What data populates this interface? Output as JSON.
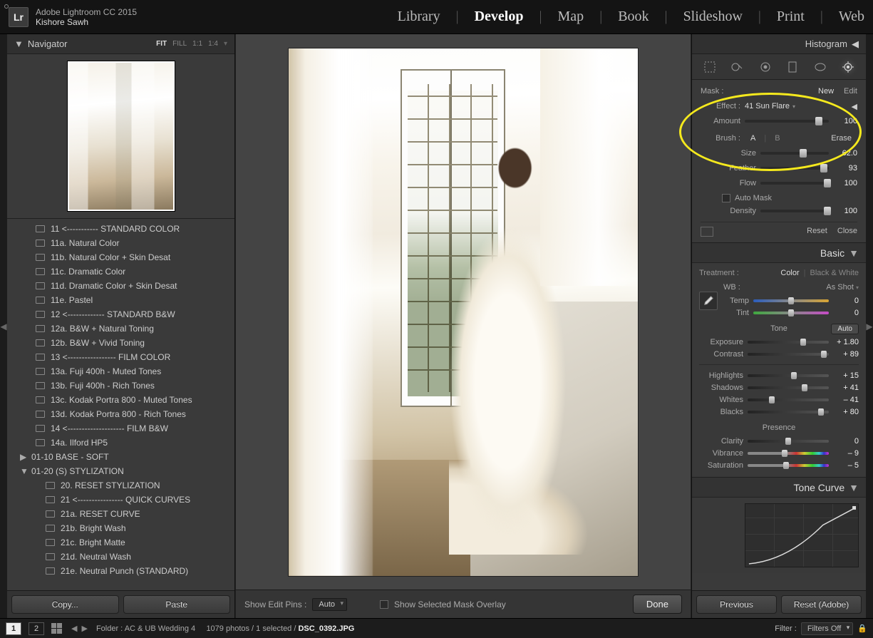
{
  "app": {
    "logo_text": "Lr",
    "title": "Adobe Lightroom CC 2015",
    "user": "Kishore Sawh"
  },
  "modules": {
    "library": "Library",
    "develop": "Develop",
    "map": "Map",
    "book": "Book",
    "slideshow": "Slideshow",
    "print": "Print",
    "web": "Web"
  },
  "navigator": {
    "title": "Navigator",
    "zoom": {
      "fit": "FIT",
      "fill": "FILL",
      "one": "1:1",
      "four": "1:4"
    }
  },
  "presets": [
    {
      "label": "11 <----------- STANDARD COLOR",
      "depth": 1
    },
    {
      "label": "11a. Natural Color",
      "depth": 1
    },
    {
      "label": "11b. Natural Color + Skin Desat",
      "depth": 1
    },
    {
      "label": "11c. Dramatic Color",
      "depth": 1
    },
    {
      "label": "11d. Dramatic Color + Skin Desat",
      "depth": 1
    },
    {
      "label": "11e. Pastel",
      "depth": 1
    },
    {
      "label": "12 <------------- STANDARD B&W",
      "depth": 1
    },
    {
      "label": "12a. B&W + Natural Toning",
      "depth": 1
    },
    {
      "label": "12b. B&W + Vivid Toning",
      "depth": 1
    },
    {
      "label": "13 <----------------- FILM COLOR",
      "depth": 1
    },
    {
      "label": "13a. Fuji 400h - Muted Tones",
      "depth": 1
    },
    {
      "label": "13b. Fuji 400h - Rich Tones",
      "depth": 1
    },
    {
      "label": "13c. Kodak Portra 800 - Muted Tones",
      "depth": 1
    },
    {
      "label": "13d. Kodak Portra 800 - Rich Tones",
      "depth": 1
    },
    {
      "label": "14 <-------------------- FILM B&W",
      "depth": 1
    },
    {
      "label": "14a. Ilford HP5",
      "depth": 1
    },
    {
      "label": "01-10 BASE - SOFT",
      "depth": 0,
      "tri": "▶"
    },
    {
      "label": "01-20 (S) STYLIZATION",
      "depth": 0,
      "tri": "▼"
    },
    {
      "label": "20. RESET STYLIZATION",
      "depth": 2
    },
    {
      "label": "21 <---------------- QUICK CURVES",
      "depth": 2
    },
    {
      "label": "21a. RESET CURVE",
      "depth": 2
    },
    {
      "label": "21b. Bright Wash",
      "depth": 2
    },
    {
      "label": "21c. Bright Matte",
      "depth": 2
    },
    {
      "label": "21d. Neutral Wash",
      "depth": 2
    },
    {
      "label": "21e. Neutral Punch (STANDARD)",
      "depth": 2
    }
  ],
  "left_buttons": {
    "copy": "Copy...",
    "paste": "Paste"
  },
  "center_footer": {
    "editpins_label": "Show Edit Pins :",
    "editpins_value": "Auto",
    "mask_label": "Show Selected Mask Overlay",
    "done": "Done"
  },
  "histogram_title": "Histogram",
  "brush": {
    "mask_label": "Mask :",
    "new": "New",
    "edit": "Edit",
    "effect_label": "Effect :",
    "effect_value": "41 Sun Flare",
    "amount_label": "Amount",
    "amount_value": "100",
    "brush_label": "Brush :",
    "a": "A",
    "b": "B",
    "erase": "Erase",
    "size_label": "Size",
    "size_value": "62.0",
    "feather_label": "Feather",
    "feather_value": "93",
    "flow_label": "Flow",
    "flow_value": "100",
    "automask": "Auto Mask",
    "density_label": "Density",
    "density_value": "100",
    "reset": "Reset",
    "close": "Close"
  },
  "basic": {
    "title": "Basic",
    "treatment_label": "Treatment :",
    "color": "Color",
    "bw": "Black & White",
    "wb_label": "WB :",
    "wb_value": "As Shot",
    "temp_label": "Temp",
    "temp_value": "0",
    "tint_label": "Tint",
    "tint_value": "0",
    "tone_label": "Tone",
    "auto": "Auto",
    "exposure_label": "Exposure",
    "exposure_value": "+ 1.80",
    "contrast_label": "Contrast",
    "contrast_value": "+ 89",
    "highlights_label": "Highlights",
    "highlights_value": "+ 15",
    "shadows_label": "Shadows",
    "shadows_value": "+ 41",
    "whites_label": "Whites",
    "whites_value": "– 41",
    "blacks_label": "Blacks",
    "blacks_value": "+ 80",
    "presence_label": "Presence",
    "clarity_label": "Clarity",
    "clarity_value": "0",
    "vibrance_label": "Vibrance",
    "vibrance_value": "– 9",
    "saturation_label": "Saturation",
    "saturation_value": "– 5"
  },
  "tonecurve_title": "Tone Curve",
  "right_buttons": {
    "previous": "Previous",
    "reset": "Reset (Adobe)"
  },
  "bottom": {
    "page1": "1",
    "page2": "2",
    "folder_label": "Folder :",
    "folder_name": "AC & UB Wedding 4",
    "count_text": "1079 photos / 1 selected /",
    "filename": "DSC_0392.JPG",
    "filter_label": "Filter :",
    "filter_value": "Filters Off"
  }
}
